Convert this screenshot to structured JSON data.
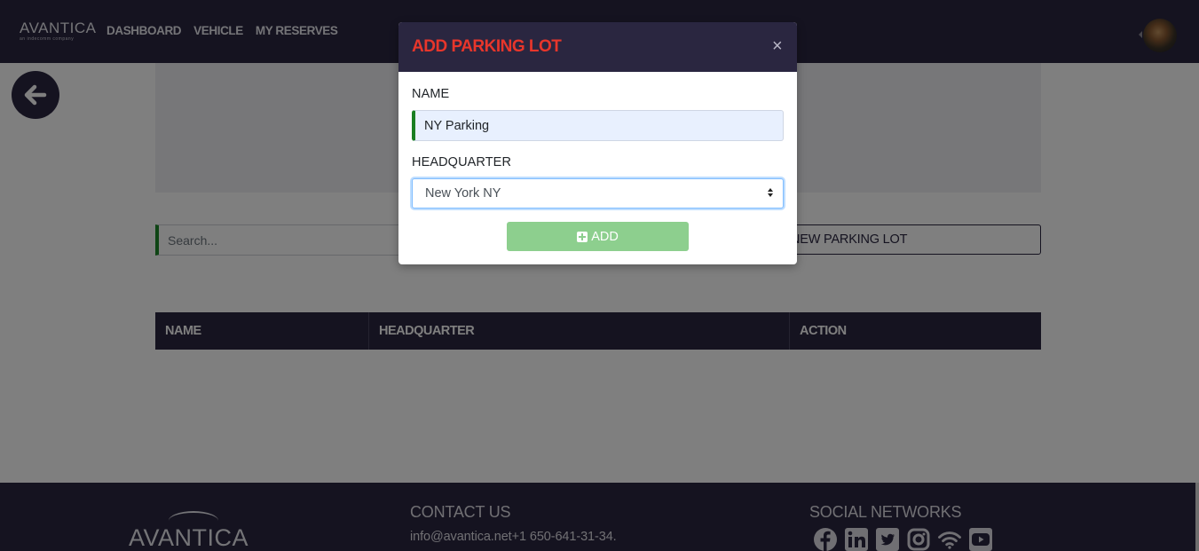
{
  "navbar": {
    "brand": "AVANTICA",
    "brand_sub": "an indecomm company",
    "links": [
      "DASHBOARD",
      "VEHICLE",
      "MY RESERVES"
    ],
    "avatar_icon": "user-avatar"
  },
  "page": {
    "back_icon": "arrow-left-icon",
    "search_placeholder": "Search...",
    "new_button_label": "NEW PARKING LOT",
    "table_headers": [
      "NAME",
      "HEADQUARTER",
      "ACTION"
    ]
  },
  "footer": {
    "brand": "AVANTICA",
    "contact_title": "CONTACT US",
    "contact_info": "info@avantica.net+1 650-641-31-34.",
    "social_title": "SOCIAL NETWORKS",
    "social_icons": [
      "facebook-icon",
      "linkedin-icon",
      "twitter-icon",
      "instagram-icon",
      "wifi-icon",
      "youtube-icon"
    ]
  },
  "modal": {
    "title": "ADD PARKING LOT",
    "close_label": "×",
    "name_label": "NAME",
    "name_value": "NY Parking",
    "headquarter_label": "HEADQUARTER",
    "headquarter_selected": "New York NY",
    "add_label": "ADD"
  },
  "colors": {
    "navy": "#2a2640",
    "title_red": "#e8362b",
    "add_green": "#8dcf8e",
    "field_green": "#1a7f22"
  }
}
